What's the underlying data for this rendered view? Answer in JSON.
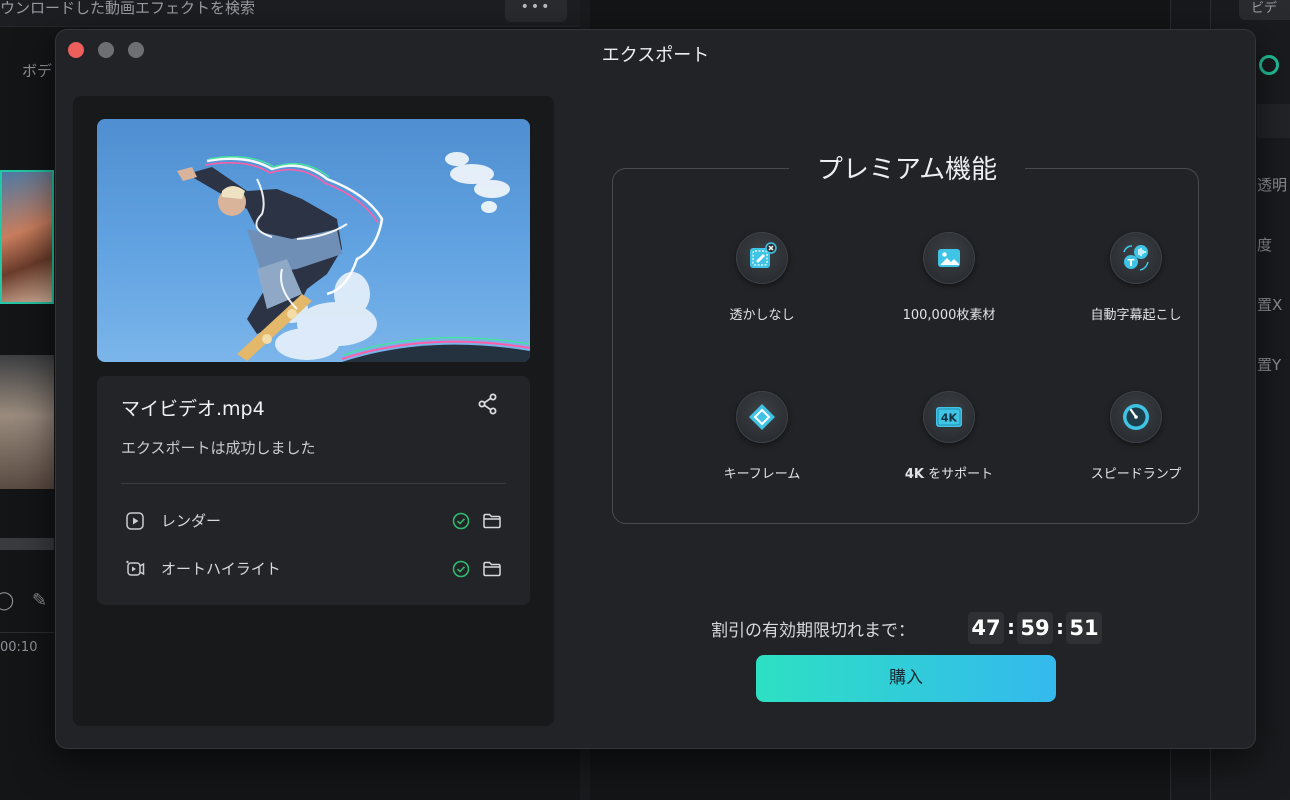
{
  "background": {
    "search_text": "ウンロードした動画エフェクトを検索",
    "more_label": "•••",
    "left_label": "ボデ",
    "right_tab": "ビデ",
    "right_labels": [
      "透明",
      "度",
      "置X",
      "置Y"
    ],
    "timecode": "00:10"
  },
  "dialog": {
    "title": "エクスポート"
  },
  "export": {
    "file_name": "マイビデオ.mp4",
    "status": "エクスポートは成功しました",
    "tasks": [
      {
        "label": "レンダー",
        "icon": "play-icon",
        "status": "complete"
      },
      {
        "label": "オートハイライト",
        "icon": "auto-highlight-icon",
        "status": "complete"
      }
    ]
  },
  "premium": {
    "title": "プレミアム機能",
    "features": [
      {
        "label": "透かしなし",
        "icon": "no-watermark-icon"
      },
      {
        "label": "100,000枚素材",
        "icon": "image-assets-icon"
      },
      {
        "label": "自動字幕起こし",
        "icon": "auto-subtitle-icon"
      },
      {
        "label": "キーフレーム",
        "icon": "keyframe-icon"
      },
      {
        "label_bold": "4K",
        "label_rest": " をサポート",
        "icon": "4k-icon",
        "badge": "4K"
      },
      {
        "label": "スピードランプ",
        "icon": "speed-ramp-icon"
      }
    ]
  },
  "countdown": {
    "label": "割引の有効期限切れまで：",
    "hours": "47",
    "minutes": "59",
    "seconds": "51",
    "separator": ":"
  },
  "buy_button": {
    "label": "購入"
  },
  "colors": {
    "accent_start": "#2de0c3",
    "accent_end": "#34b9ee",
    "check_green": "#2fbf71",
    "close_red": "#ec5f5d"
  }
}
